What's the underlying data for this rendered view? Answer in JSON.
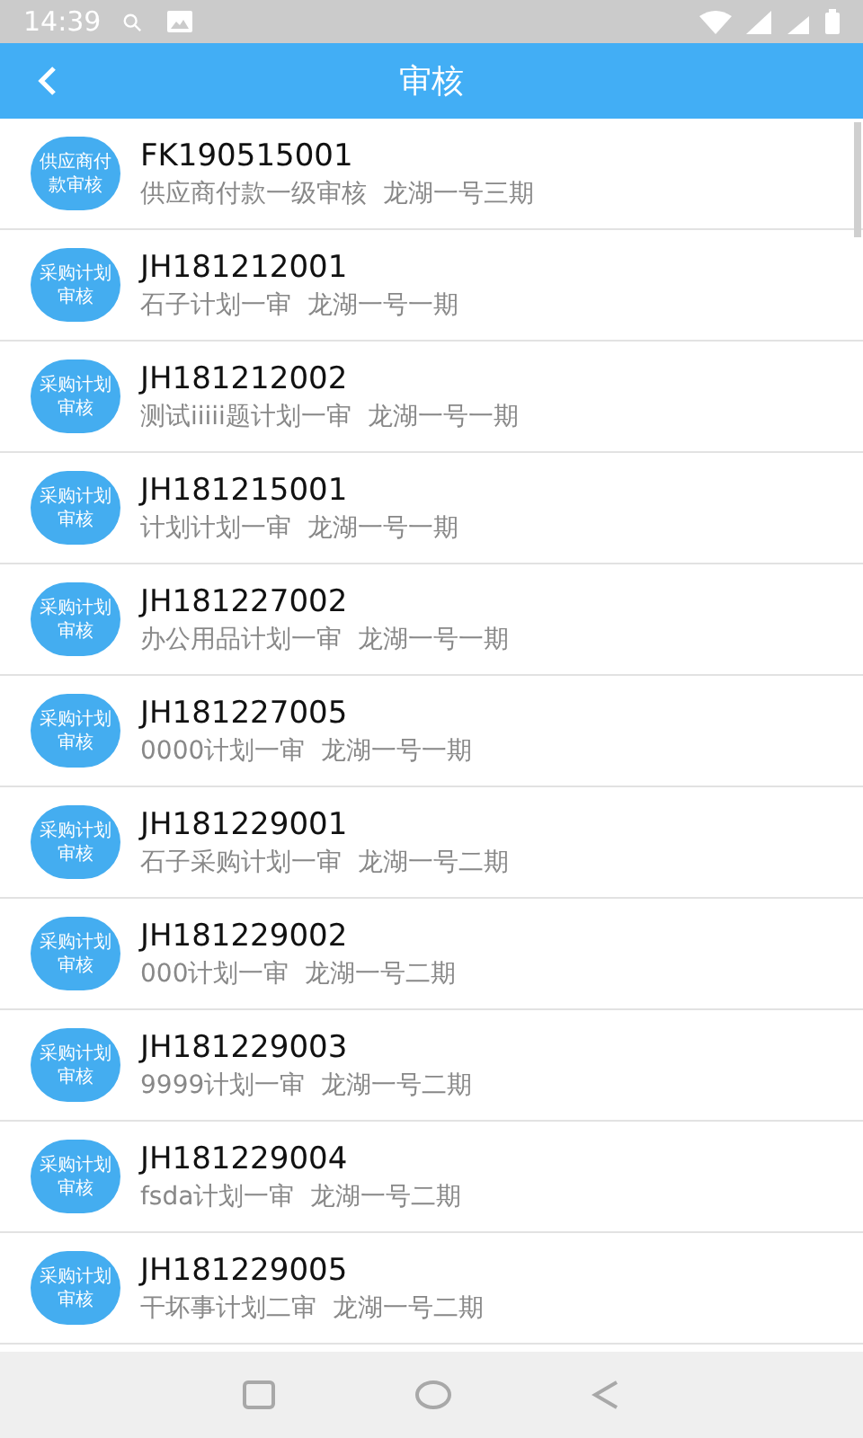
{
  "status_bar": {
    "time": "14:39"
  },
  "header": {
    "title": "审核"
  },
  "items": [
    {
      "avatar_lines": [
        "供应商付",
        "款审核"
      ],
      "code": "FK190515001",
      "description": "供应商付款一级审核  龙湖一号三期"
    },
    {
      "avatar_lines": [
        "采购计划",
        "审核"
      ],
      "code": "JH181212001",
      "description": "石子计划一审  龙湖一号一期"
    },
    {
      "avatar_lines": [
        "采购计划",
        "审核"
      ],
      "code": "JH181212002",
      "description": "测试iiiii题计划一审  龙湖一号一期"
    },
    {
      "avatar_lines": [
        "采购计划",
        "审核"
      ],
      "code": "JH181215001",
      "description": "计划计划一审  龙湖一号一期"
    },
    {
      "avatar_lines": [
        "采购计划",
        "审核"
      ],
      "code": "JH181227002",
      "description": "办公用品计划一审  龙湖一号一期"
    },
    {
      "avatar_lines": [
        "采购计划",
        "审核"
      ],
      "code": "JH181227005",
      "description": "0000计划一审  龙湖一号一期"
    },
    {
      "avatar_lines": [
        "采购计划",
        "审核"
      ],
      "code": "JH181229001",
      "description": "石子采购计划一审  龙湖一号二期"
    },
    {
      "avatar_lines": [
        "采购计划",
        "审核"
      ],
      "code": "JH181229002",
      "description": "000计划一审  龙湖一号二期"
    },
    {
      "avatar_lines": [
        "采购计划",
        "审核"
      ],
      "code": "JH181229003",
      "description": "9999计划一审  龙湖一号二期"
    },
    {
      "avatar_lines": [
        "采购计划",
        "审核"
      ],
      "code": "JH181229004",
      "description": "fsda计划一审  龙湖一号二期"
    },
    {
      "avatar_lines": [
        "采购计划",
        "审核"
      ],
      "code": "JH181229005",
      "description": "干坏事计划二审  龙湖一号二期"
    }
  ]
}
